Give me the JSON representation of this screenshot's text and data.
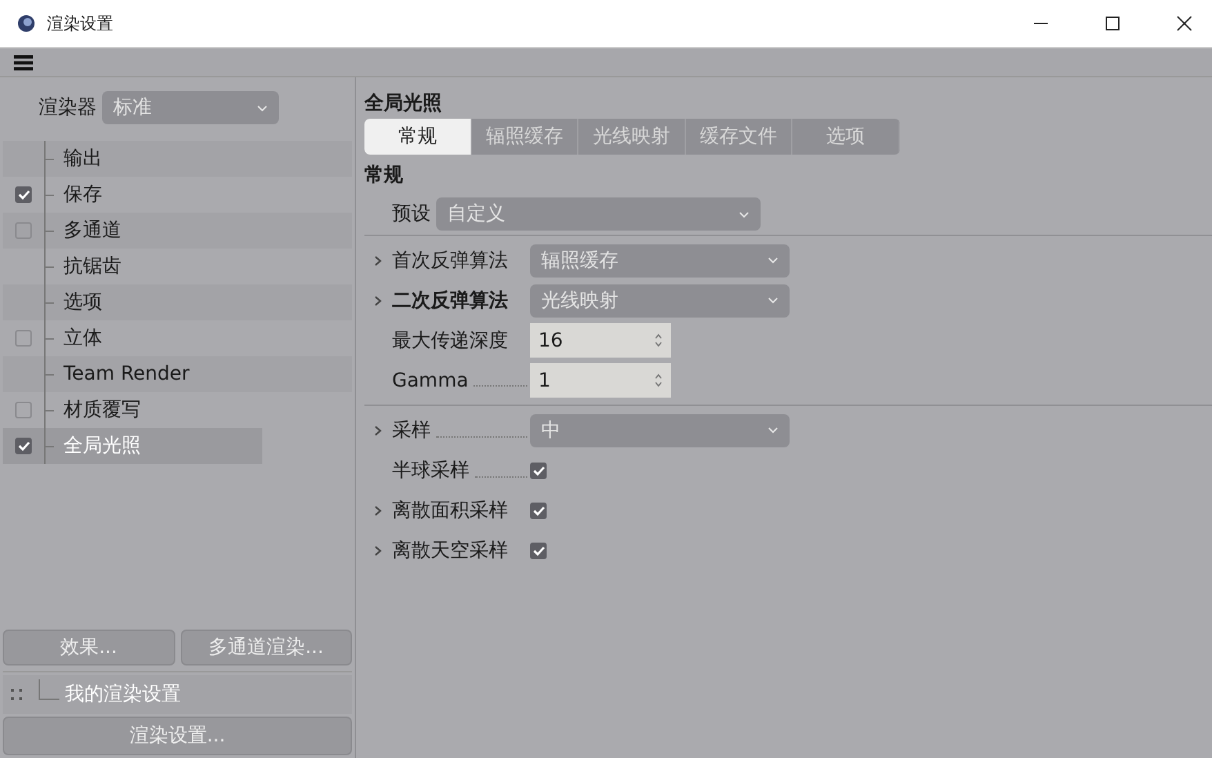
{
  "window": {
    "title": "渲染设置"
  },
  "renderer": {
    "label": "渲染器",
    "value": "标准"
  },
  "sidebar": {
    "items": [
      {
        "label": "输出",
        "kind": "plain",
        "selected": false
      },
      {
        "label": "保存",
        "kind": "check",
        "checked": true,
        "selected": false
      },
      {
        "label": "多通道",
        "kind": "check",
        "checked": false,
        "selected": false
      },
      {
        "label": "抗锯齿",
        "kind": "plain",
        "selected": false
      },
      {
        "label": "选项",
        "kind": "plain",
        "selected": false
      },
      {
        "label": "立体",
        "kind": "check",
        "checked": false,
        "selected": false
      },
      {
        "label": "Team Render",
        "kind": "plain",
        "selected": false
      },
      {
        "label": "材质覆写",
        "kind": "check",
        "checked": false,
        "selected": false
      },
      {
        "label": "全局光照",
        "kind": "check",
        "checked": true,
        "selected": true
      }
    ]
  },
  "sidebar_buttons": [
    "效果...",
    "多通道渲染..."
  ],
  "preset_entry": "我的渲染设置",
  "render_settings_button": "渲染设置...",
  "heading": "全局光照",
  "tabs": [
    {
      "label": "常规",
      "selected": true
    },
    {
      "label": "辐照缓存",
      "selected": false
    },
    {
      "label": "光线映射",
      "selected": false
    },
    {
      "label": "缓存文件",
      "selected": false
    },
    {
      "label": "选项",
      "selected": false
    }
  ],
  "section": "常规",
  "preset": {
    "label": "预设",
    "value": "自定义"
  },
  "groups": [
    [
      {
        "label": "首次反弹算法",
        "kind": "select",
        "value": "辐照缓存",
        "expander": true,
        "bold": false,
        "leader": false
      },
      {
        "label": "二次反弹算法",
        "kind": "select",
        "value": "光线映射",
        "expander": true,
        "bold": true,
        "leader": false
      },
      {
        "label": "最大传递深度",
        "kind": "number",
        "value": "16",
        "expander": false,
        "bold": false,
        "leader": false
      },
      {
        "label": "Gamma",
        "kind": "number",
        "value": "1",
        "expander": false,
        "bold": false,
        "leader": true
      }
    ],
    [
      {
        "label": "采样",
        "kind": "select",
        "value": "中",
        "expander": true,
        "bold": false,
        "leader": true
      },
      {
        "label": "半球采样",
        "kind": "checkbox",
        "checked": true,
        "expander": false,
        "bold": false,
        "leader": true
      },
      {
        "label": "离散面积采样",
        "kind": "checkbox",
        "checked": true,
        "expander": true,
        "bold": false,
        "leader": false
      },
      {
        "label": "离散天空采样",
        "kind": "checkbox",
        "checked": true,
        "expander": true,
        "bold": false,
        "leader": false
      }
    ]
  ]
}
